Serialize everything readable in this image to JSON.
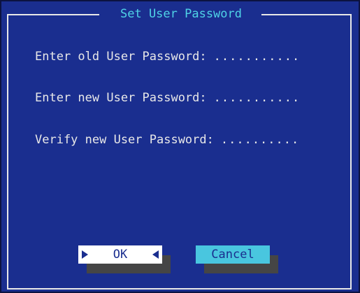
{
  "dialog": {
    "title": "Set User Password",
    "fields": [
      {
        "label": "Enter old User Password:",
        "value": "..........."
      },
      {
        "label": "Enter new User Password:",
        "value": "..........."
      },
      {
        "label": "Verify new User Password:",
        "value": ".........."
      }
    ],
    "buttons": {
      "ok": "OK",
      "cancel": "Cancel"
    }
  },
  "colors": {
    "background": "#1a2e8f",
    "title": "#4fd3e6",
    "text": "#e8e8e8",
    "button": "#49c6df",
    "button_selected": "#ffffff",
    "button_shadow": "#454545"
  }
}
